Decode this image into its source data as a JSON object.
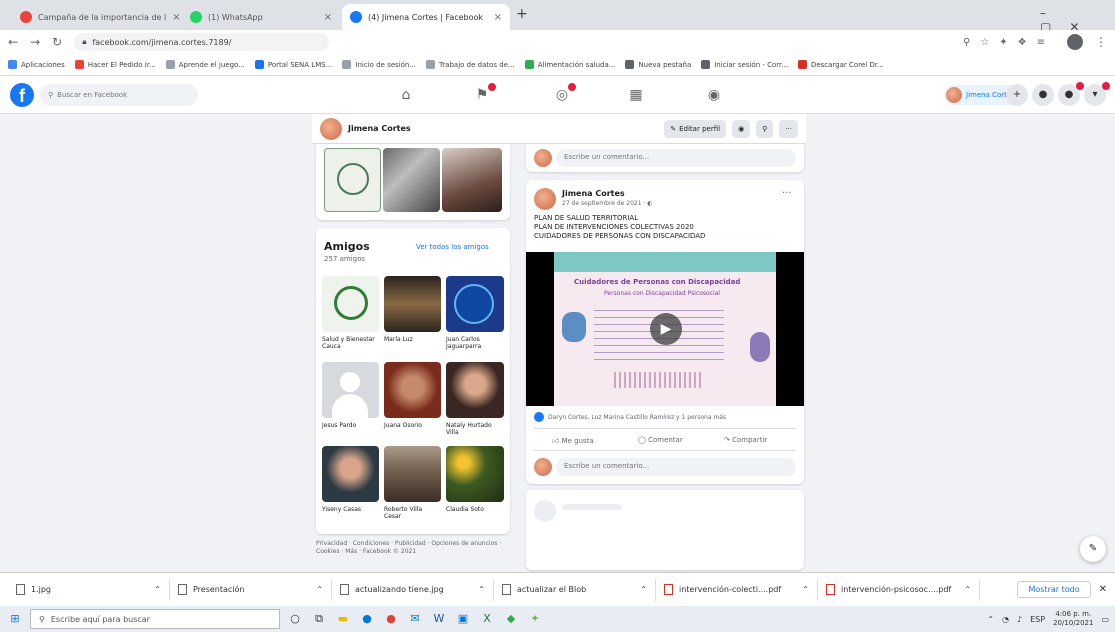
{
  "browser": {
    "tabs": [
      {
        "label": "Campaña de la importancia de l",
        "color": "#e8453c"
      },
      {
        "label": "(1) WhatsApp",
        "color": "#25d366"
      },
      {
        "label": "(4) Jimena Cortes | Facebook",
        "color": "#1877f2"
      }
    ],
    "url": "facebook.com/jimena.cortes.7189/",
    "bookmarks": [
      "Aplicaciones",
      "Hacer El Pedido Ir...",
      "Aprende el juego...",
      "Portal SENA LMS...",
      "Inicio de sesión...",
      "Trabajo de datos de...",
      "Alimentación saluda...",
      "Nueva pestaña",
      "Iniciar sesión - Corr...",
      "Descargar Corel Dr..."
    ]
  },
  "fb": {
    "search_placeholder": "Buscar en Facebook",
    "profile_name": "Jimena Cortes",
    "edit_profile": "Editar perfil",
    "friends_title": "Amigos",
    "friends_count": "257 amigos",
    "see_all": "Ver todos los amigos",
    "friends": [
      {
        "name": "Salud y Bienestar Cauca",
        "bg": "#eef3ee"
      },
      {
        "name": "María Luz",
        "bg": "#5b4a3a"
      },
      {
        "name": "Juan Carlos Jaguarparra",
        "bg": "#1b3a8a"
      },
      {
        "name": "Jesus Pardo",
        "bg": "#d6d9de"
      },
      {
        "name": "Juana Osorio",
        "bg": "#7a2b1c"
      },
      {
        "name": "Nataly Hurtado Villa",
        "bg": "#3a2622"
      },
      {
        "name": "Yiseny Casas",
        "bg": "#2c3a44"
      },
      {
        "name": "Roberto Villa Cesar",
        "bg": "#6d5a4a"
      },
      {
        "name": "Claudia Soto",
        "bg": "#3d5a22"
      }
    ],
    "footer_links": "Privacidad · Condiciones · Publicidad · Opciones de anuncios · Cookies · Más · Facebook © 2021",
    "comment_placeholder": "Escribe un comentario...",
    "post": {
      "author": "Jimena Cortes",
      "date": "27 de septiembre de 2021",
      "text_lines": [
        "PLAN DE SALUD TERRITORIAL",
        "PLAN DE INTERVENCIONES COLECTIVAS 2020",
        "CUIDADORES DE PERSONAS CON DISCAPACIDAD"
      ],
      "video_title_1": "Cuidadores de Personas con Discapacidad",
      "video_title_2": "Personas con Discapacidad Psicosocial",
      "reactions": "Daryn Cortes, Luz Marina Castillo Ramírez y 1 persona más",
      "like": "Me gusta",
      "comment": "Comentar",
      "share": "Compartir"
    }
  },
  "downloads": [
    "1.jpg",
    "Presentación",
    "actualizando tiene.jpg",
    "actualizar el Blob",
    "intervención-colecti....pdf",
    "intervención-psicosoc....pdf"
  ],
  "show_all": "Mostrar todo",
  "taskbar": {
    "search": "Escribe aquí para buscar",
    "time": "4:06 p. m.",
    "date": "20/10/2021",
    "lang": "ESP"
  }
}
